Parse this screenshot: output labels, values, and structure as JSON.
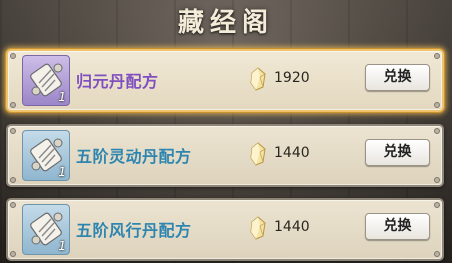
{
  "header": {
    "title": "藏经阁"
  },
  "currency": {
    "icon": "crystal-currency-icon"
  },
  "items": [
    {
      "name": "归元丹配方",
      "quantity": "1",
      "price": "1920",
      "button_label": "兑换",
      "selected": true,
      "icon": "scroll-icon",
      "rarity_color": "#7f4fbf"
    },
    {
      "name": "五阶灵动丹配方",
      "quantity": "1",
      "price": "1440",
      "button_label": "兑换",
      "selected": false,
      "icon": "scroll-icon",
      "rarity_color": "#2e86b0"
    },
    {
      "name": "五阶风行丹配方",
      "quantity": "1",
      "price": "1440",
      "button_label": "兑换",
      "selected": false,
      "icon": "scroll-icon",
      "rarity_color": "#2e86b0"
    }
  ]
}
